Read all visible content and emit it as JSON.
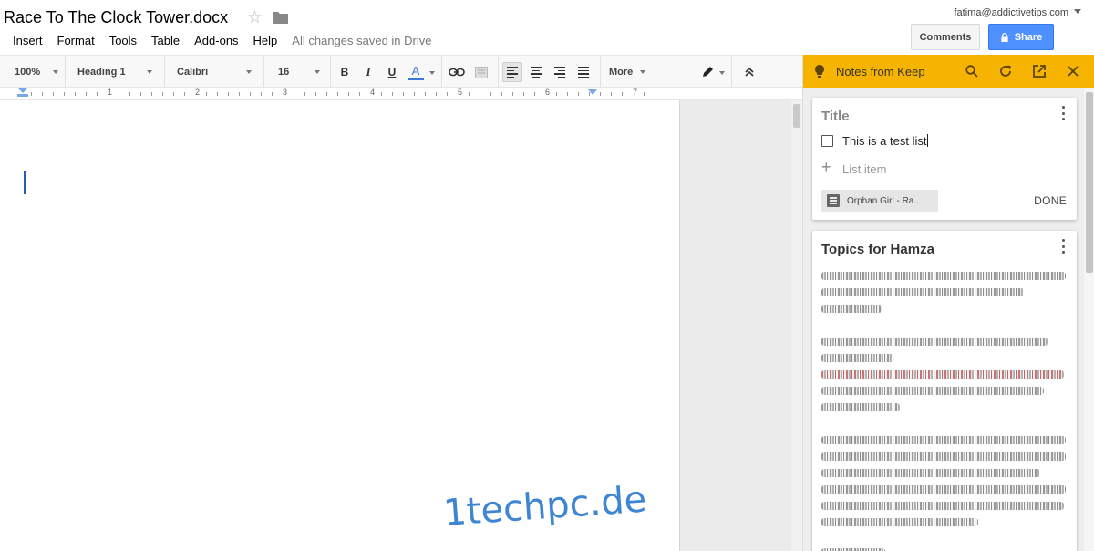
{
  "document": {
    "title": "Race To The Clock Tower.docx",
    "save_status": "All changes saved in Drive"
  },
  "menu": [
    "Insert",
    "Format",
    "Tools",
    "Table",
    "Add-ons",
    "Help"
  ],
  "account": {
    "email": "fatima@addictivetips.com",
    "comments_label": "Comments",
    "share_label": "Share"
  },
  "toolbar": {
    "zoom": "100%",
    "style": "Heading 1",
    "font": "Calibri",
    "size": "16",
    "more_label": "More",
    "bold": "B",
    "italic": "I",
    "underline": "U",
    "text_color": "A",
    "text_color_hex": "#3c78d8"
  },
  "ruler": {
    "numbers": [
      "1",
      "2",
      "3",
      "4",
      "5",
      "6",
      "7"
    ]
  },
  "keep": {
    "header_title": "Notes from Keep",
    "header_color": "#f6b400",
    "note1": {
      "title_placeholder": "Title",
      "item_text": "This is a test list",
      "add_placeholder": "List item",
      "chip_label": "Orphan Girl - Ra...",
      "done_label": "DONE"
    },
    "note2": {
      "title": "Topics for Hamza"
    }
  },
  "watermark": "1techpc.de"
}
